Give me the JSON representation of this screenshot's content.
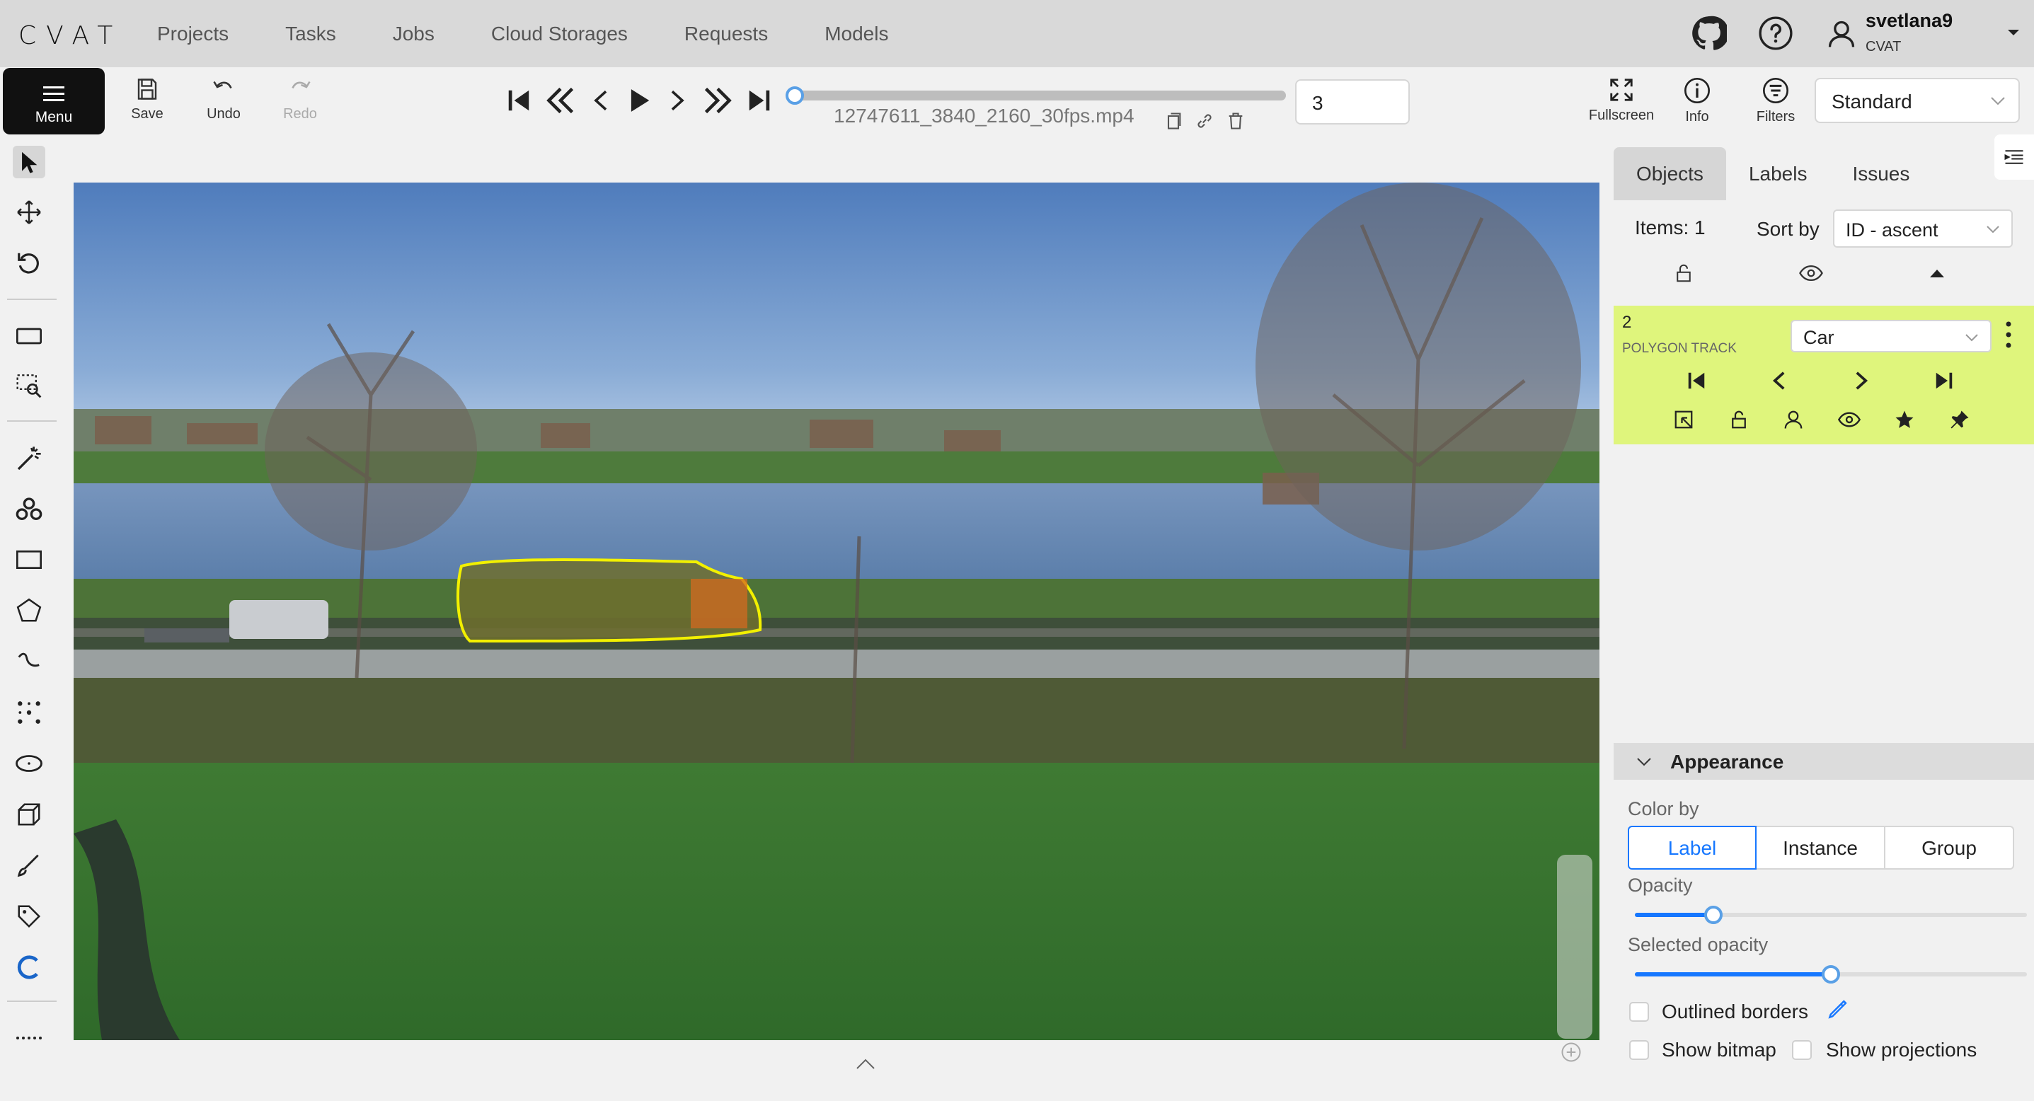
{
  "app": {
    "logo": "CVAT"
  },
  "nav": {
    "items": [
      "Projects",
      "Tasks",
      "Jobs",
      "Cloud Storages",
      "Requests",
      "Models"
    ]
  },
  "user": {
    "name": "svetlana9",
    "org": "CVAT"
  },
  "toolbar": {
    "menu_label": "Menu",
    "save_label": "Save",
    "undo_label": "Undo",
    "redo_label": "Redo",
    "filename": "12747611_3840_2160_30fps.mp4",
    "frame_value": "3",
    "fullscreen_label": "Fullscreen",
    "info_label": "Info",
    "filters_label": "Filters",
    "workspace_value": "Standard",
    "player_progress": 0.0
  },
  "sidebar": {
    "tabs": [
      "Objects",
      "Labels",
      "Issues"
    ],
    "items_label": "Items: 1",
    "sort_label": "Sort by",
    "sort_value": "ID - ascent",
    "object": {
      "id": "2",
      "type": "POLYGON TRACK",
      "label": "Car"
    },
    "appearance": {
      "title": "Appearance",
      "color_by_label": "Color by",
      "color_by_options": [
        "Label",
        "Instance",
        "Group"
      ],
      "color_by_selected": "Label",
      "opacity_label": "Opacity",
      "opacity_value": 0.2,
      "selected_opacity_label": "Selected opacity",
      "selected_opacity_value": 0.5,
      "outlined_borders_label": "Outlined borders",
      "show_bitmap_label": "Show bitmap",
      "show_projections_label": "Show projections"
    }
  },
  "colors": {
    "accent": "#1677ff",
    "object_card": "#dff57c",
    "polygon": "#f2f000"
  }
}
